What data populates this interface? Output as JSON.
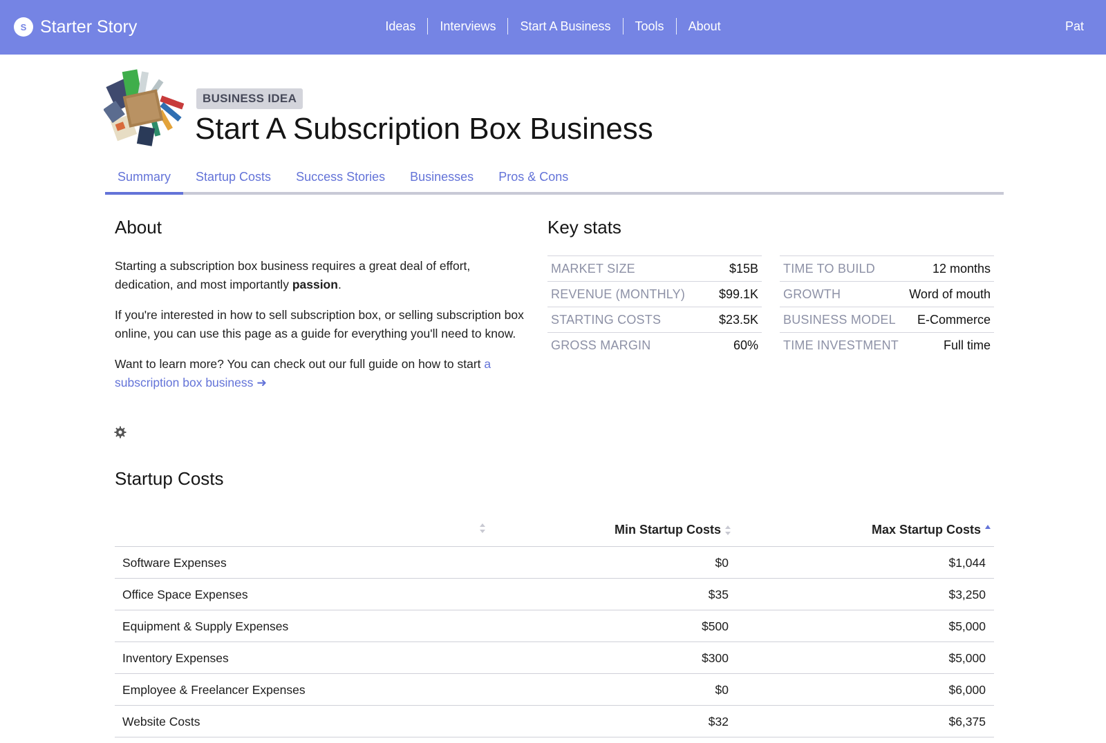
{
  "nav": {
    "brand_letter": "S",
    "brand_name": "Starter Story",
    "links": [
      "Ideas",
      "Interviews",
      "Start A Business",
      "Tools",
      "About"
    ],
    "user": "Pat"
  },
  "header": {
    "badge": "BUSINESS IDEA",
    "title": "Start A Subscription Box Business"
  },
  "tabs": [
    "Summary",
    "Startup Costs",
    "Success Stories",
    "Businesses",
    "Pros & Cons"
  ],
  "about": {
    "heading": "About",
    "p1_text": "Starting a subscription box business requires a great deal of effort, dedication, and most importantly ",
    "p1_bold": "passion",
    "p1_end": ".",
    "p2": "If you're interested in how to sell subscription box, or selling subscription box online, you can use this page as a guide for everything you'll need to know.",
    "p3_text": "Want to learn more? You can check out our full guide on how to start ",
    "p3_link": "a subscription box business",
    "p3_arrow": "➜"
  },
  "key_stats": {
    "heading": "Key stats",
    "left": [
      {
        "label": "MARKET SIZE",
        "value": "$15B"
      },
      {
        "label": "REVENUE (MONTHLY)",
        "value": "$99.1K"
      },
      {
        "label": "STARTING COSTS",
        "value": "$23.5K"
      },
      {
        "label": "GROSS MARGIN",
        "value": "60%"
      }
    ],
    "right": [
      {
        "label": "TIME TO BUILD",
        "value": "12 months"
      },
      {
        "label": "GROWTH",
        "value": "Word of mouth"
      },
      {
        "label": "BUSINESS MODEL",
        "value": "E-Commerce"
      },
      {
        "label": "TIME INVESTMENT",
        "value": "Full time"
      }
    ]
  },
  "startup_costs": {
    "heading": "Startup Costs",
    "col_min": "Min Startup Costs",
    "col_max": "Max Startup Costs",
    "rows": [
      {
        "name": "Software Expenses",
        "min": "$0",
        "max": "$1,044"
      },
      {
        "name": "Office Space Expenses",
        "min": "$35",
        "max": "$3,250"
      },
      {
        "name": "Equipment & Supply Expenses",
        "min": "$500",
        "max": "$5,000"
      },
      {
        "name": "Inventory Expenses",
        "min": "$300",
        "max": "$5,000"
      },
      {
        "name": "Employee & Freelancer Expenses",
        "min": "$0",
        "max": "$6,000"
      },
      {
        "name": "Website Costs",
        "min": "$32",
        "max": "$6,375"
      }
    ]
  },
  "colors": {
    "nav_bg": "#7584e4",
    "accent": "#6373d8",
    "muted_label": "#8d91a6"
  }
}
